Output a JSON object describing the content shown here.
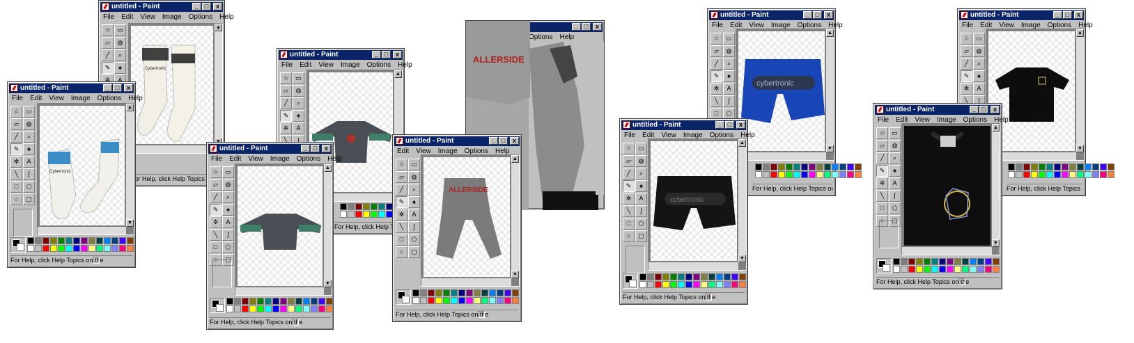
{
  "window": {
    "title": "untitled - Paint",
    "menus": [
      "File",
      "Edit",
      "View",
      "Image",
      "Options",
      "Help"
    ],
    "status": "For Help, click Help Topics on the",
    "controls": {
      "minimize": "_",
      "maximize": "□",
      "close": "x"
    }
  },
  "palette": [
    "#000000",
    "#808080",
    "#800000",
    "#808000",
    "#008000",
    "#008080",
    "#000080",
    "#800080",
    "#808040",
    "#004040",
    "#0080ff",
    "#004080",
    "#4000ff",
    "#804000",
    "#ffffff",
    "#c0c0c0",
    "#ff0000",
    "#ffff00",
    "#00ff00",
    "#00ffff",
    "#0000ff",
    "#ff00ff",
    "#ffff80",
    "#00ff80",
    "#80ffff",
    "#8080ff",
    "#ff0080",
    "#ff8040"
  ],
  "tools": [
    "free-select",
    "rect-select",
    "eraser",
    "fill",
    "picker",
    "magnifier",
    "pencil",
    "brush",
    "airbrush",
    "text",
    "line",
    "curve",
    "rectangle",
    "polygon",
    "ellipse",
    "rounded-rect"
  ],
  "items": {
    "socks_print": "Cybertronic",
    "pants_print": "ALLERSIDE",
    "shorts_blue_print": "cybertronic",
    "shorts_black_print": "cybertronic"
  }
}
